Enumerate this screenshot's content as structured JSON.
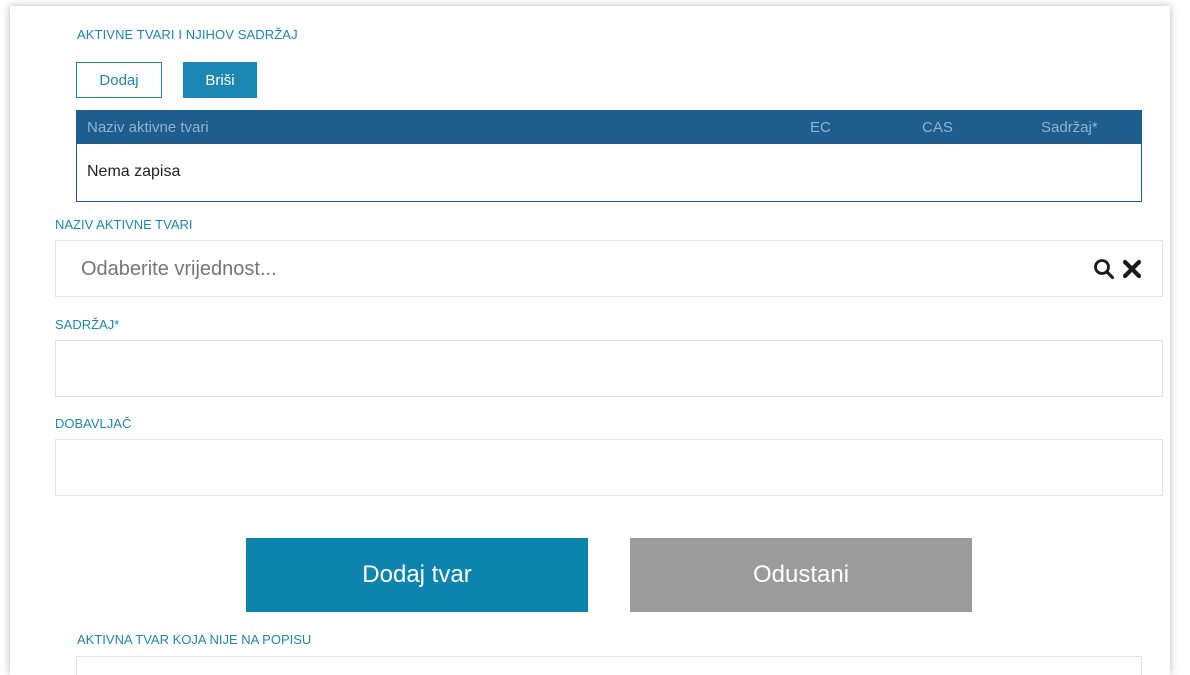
{
  "section": {
    "title": "AKTIVNE TVARI I NJIHOV SADRŽAJ",
    "add_label": "Dodaj",
    "delete_label": "Briši"
  },
  "table": {
    "columns": [
      "Naziv aktivne tvari",
      "EC",
      "CAS",
      "Sadržaj*"
    ],
    "empty_text": "Nema zapisa"
  },
  "fields": {
    "substance_name": {
      "label": "NAZIV AKTIVNE TVARI",
      "placeholder": "Odaberite vrijednost...",
      "search_icon": "search-icon",
      "clear_icon": "close-icon"
    },
    "content": {
      "label": "SADRŽAJ*",
      "value": ""
    },
    "supplier": {
      "label": "DOBAVLJAČ",
      "value": ""
    }
  },
  "actions": {
    "add_substance_label": "Dodaj tvar",
    "cancel_label": "Odustani"
  },
  "bottom_section": {
    "title": "AKTIVNA TVAR KOJA NIJE NA POPISU"
  },
  "colors": {
    "accent": "#1a87b5",
    "table_header": "#1e5d8c",
    "primary_button": "#0d84ad",
    "cancel_button": "#9b9b9b"
  }
}
